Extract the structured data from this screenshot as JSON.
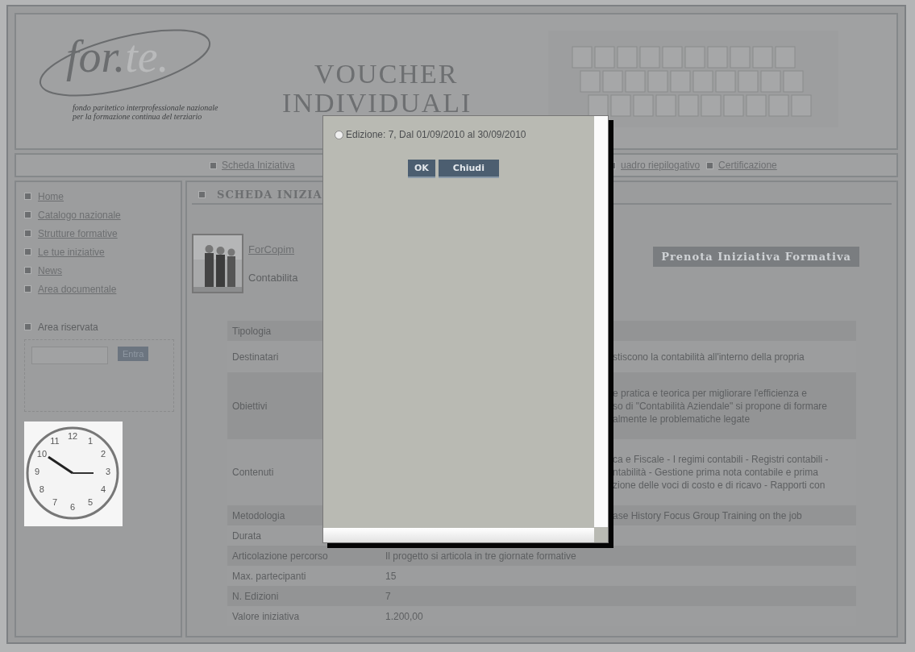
{
  "header": {
    "logo": {
      "main": "for.",
      "accent": "te.",
      "tagline": [
        "fondo paritetico interprofessionale nazionale",
        "per la formazione continua del terziario"
      ]
    },
    "title_lines": [
      "VOUCHER",
      "INDIVIDUALI"
    ]
  },
  "nav": [
    {
      "label": "Scheda Iniziativa",
      "covered": false
    },
    {
      "label": "uadro riepilogativo",
      "covered": true
    },
    {
      "label": "Certificazione",
      "covered": false
    }
  ],
  "sidebar": {
    "items": [
      "Home",
      "Catalogo nazionale",
      "Strutture formative",
      "Le tue iniziative",
      "News",
      "Area documentale"
    ],
    "reserved": {
      "title": "Area riservata",
      "button": "Entra"
    },
    "clock": {
      "numerals": [
        "12",
        "1",
        "2",
        "3",
        "4",
        "5",
        "6",
        "7",
        "8",
        "9",
        "10",
        "11"
      ]
    }
  },
  "section": {
    "title": "SCHEDA INIZIA",
    "provider": "ForCopim",
    "course": "Contabilita",
    "book_button": "Prenota Iniziativa Formativa"
  },
  "table": {
    "rows": [
      {
        "label": "Tipologia",
        "lines": []
      },
      {
        "label": "Destinatari",
        "covered": true,
        "lines": [
          "stiscono la contabilità all'interno della propria"
        ]
      },
      {
        "label": "Obiettivi",
        "covered": true,
        "lines": [
          "e pratica e teorica per migliorare l'efficienza e",
          "so di \"Contabilità Aziendale\" si propone di formare",
          "almente le problematiche legate"
        ]
      },
      {
        "label": "Contenuti",
        "covered": true,
        "lines": [
          "ca e Fiscale - I regimi contabili - Registri contabili -",
          "ntabilità - Gestione prima nota contabile e prima",
          "zione delle voci di costo e di ricavo - Rapporti con"
        ]
      },
      {
        "label": "Metodologia",
        "covered": true,
        "lines": [
          "ase History Focus Group Training on the job"
        ]
      },
      {
        "label": "Durata",
        "lines": []
      },
      {
        "label": "Articolazione percorso",
        "covered": false,
        "lines": [
          "Il progetto si articola in tre giornate formative"
        ]
      },
      {
        "label": "Max. partecipanti",
        "covered": false,
        "lines": [
          "15"
        ]
      },
      {
        "label": "N. Edizioni",
        "covered": false,
        "lines": [
          "7"
        ]
      },
      {
        "label": "Valore iniziativa",
        "covered": false,
        "lines": [
          "1.200,00"
        ]
      }
    ]
  },
  "dialog": {
    "options": [
      {
        "label": "Edizione: 7, Dal 01/09/2010 al 30/09/2010",
        "selected": false
      }
    ],
    "buttons": [
      "OK",
      "Chiudi"
    ]
  }
}
